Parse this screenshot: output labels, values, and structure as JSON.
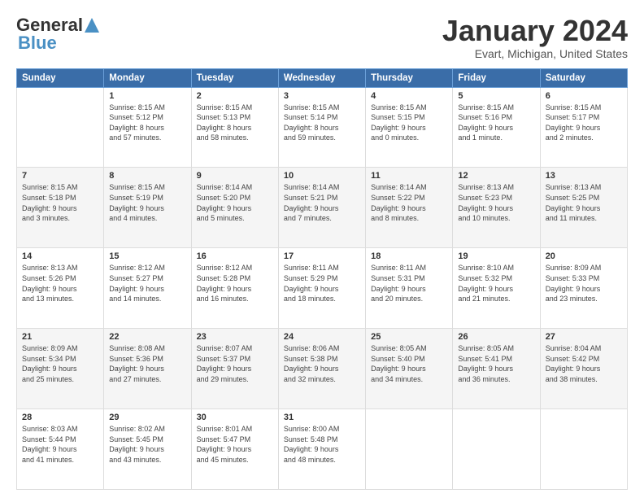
{
  "header": {
    "logo_line1": "General",
    "logo_line2": "Blue",
    "title": "January 2024",
    "subtitle": "Evart, Michigan, United States"
  },
  "weekdays": [
    "Sunday",
    "Monday",
    "Tuesday",
    "Wednesday",
    "Thursday",
    "Friday",
    "Saturday"
  ],
  "weeks": [
    [
      {
        "day": "",
        "info": ""
      },
      {
        "day": "1",
        "info": "Sunrise: 8:15 AM\nSunset: 5:12 PM\nDaylight: 8 hours\nand 57 minutes."
      },
      {
        "day": "2",
        "info": "Sunrise: 8:15 AM\nSunset: 5:13 PM\nDaylight: 8 hours\nand 58 minutes."
      },
      {
        "day": "3",
        "info": "Sunrise: 8:15 AM\nSunset: 5:14 PM\nDaylight: 8 hours\nand 59 minutes."
      },
      {
        "day": "4",
        "info": "Sunrise: 8:15 AM\nSunset: 5:15 PM\nDaylight: 9 hours\nand 0 minutes."
      },
      {
        "day": "5",
        "info": "Sunrise: 8:15 AM\nSunset: 5:16 PM\nDaylight: 9 hours\nand 1 minute."
      },
      {
        "day": "6",
        "info": "Sunrise: 8:15 AM\nSunset: 5:17 PM\nDaylight: 9 hours\nand 2 minutes."
      }
    ],
    [
      {
        "day": "7",
        "info": "Sunrise: 8:15 AM\nSunset: 5:18 PM\nDaylight: 9 hours\nand 3 minutes."
      },
      {
        "day": "8",
        "info": "Sunrise: 8:15 AM\nSunset: 5:19 PM\nDaylight: 9 hours\nand 4 minutes."
      },
      {
        "day": "9",
        "info": "Sunrise: 8:14 AM\nSunset: 5:20 PM\nDaylight: 9 hours\nand 5 minutes."
      },
      {
        "day": "10",
        "info": "Sunrise: 8:14 AM\nSunset: 5:21 PM\nDaylight: 9 hours\nand 7 minutes."
      },
      {
        "day": "11",
        "info": "Sunrise: 8:14 AM\nSunset: 5:22 PM\nDaylight: 9 hours\nand 8 minutes."
      },
      {
        "day": "12",
        "info": "Sunrise: 8:13 AM\nSunset: 5:23 PM\nDaylight: 9 hours\nand 10 minutes."
      },
      {
        "day": "13",
        "info": "Sunrise: 8:13 AM\nSunset: 5:25 PM\nDaylight: 9 hours\nand 11 minutes."
      }
    ],
    [
      {
        "day": "14",
        "info": "Sunrise: 8:13 AM\nSunset: 5:26 PM\nDaylight: 9 hours\nand 13 minutes."
      },
      {
        "day": "15",
        "info": "Sunrise: 8:12 AM\nSunset: 5:27 PM\nDaylight: 9 hours\nand 14 minutes."
      },
      {
        "day": "16",
        "info": "Sunrise: 8:12 AM\nSunset: 5:28 PM\nDaylight: 9 hours\nand 16 minutes."
      },
      {
        "day": "17",
        "info": "Sunrise: 8:11 AM\nSunset: 5:29 PM\nDaylight: 9 hours\nand 18 minutes."
      },
      {
        "day": "18",
        "info": "Sunrise: 8:11 AM\nSunset: 5:31 PM\nDaylight: 9 hours\nand 20 minutes."
      },
      {
        "day": "19",
        "info": "Sunrise: 8:10 AM\nSunset: 5:32 PM\nDaylight: 9 hours\nand 21 minutes."
      },
      {
        "day": "20",
        "info": "Sunrise: 8:09 AM\nSunset: 5:33 PM\nDaylight: 9 hours\nand 23 minutes."
      }
    ],
    [
      {
        "day": "21",
        "info": "Sunrise: 8:09 AM\nSunset: 5:34 PM\nDaylight: 9 hours\nand 25 minutes."
      },
      {
        "day": "22",
        "info": "Sunrise: 8:08 AM\nSunset: 5:36 PM\nDaylight: 9 hours\nand 27 minutes."
      },
      {
        "day": "23",
        "info": "Sunrise: 8:07 AM\nSunset: 5:37 PM\nDaylight: 9 hours\nand 29 minutes."
      },
      {
        "day": "24",
        "info": "Sunrise: 8:06 AM\nSunset: 5:38 PM\nDaylight: 9 hours\nand 32 minutes."
      },
      {
        "day": "25",
        "info": "Sunrise: 8:05 AM\nSunset: 5:40 PM\nDaylight: 9 hours\nand 34 minutes."
      },
      {
        "day": "26",
        "info": "Sunrise: 8:05 AM\nSunset: 5:41 PM\nDaylight: 9 hours\nand 36 minutes."
      },
      {
        "day": "27",
        "info": "Sunrise: 8:04 AM\nSunset: 5:42 PM\nDaylight: 9 hours\nand 38 minutes."
      }
    ],
    [
      {
        "day": "28",
        "info": "Sunrise: 8:03 AM\nSunset: 5:44 PM\nDaylight: 9 hours\nand 41 minutes."
      },
      {
        "day": "29",
        "info": "Sunrise: 8:02 AM\nSunset: 5:45 PM\nDaylight: 9 hours\nand 43 minutes."
      },
      {
        "day": "30",
        "info": "Sunrise: 8:01 AM\nSunset: 5:47 PM\nDaylight: 9 hours\nand 45 minutes."
      },
      {
        "day": "31",
        "info": "Sunrise: 8:00 AM\nSunset: 5:48 PM\nDaylight: 9 hours\nand 48 minutes."
      },
      {
        "day": "",
        "info": ""
      },
      {
        "day": "",
        "info": ""
      },
      {
        "day": "",
        "info": ""
      }
    ]
  ]
}
